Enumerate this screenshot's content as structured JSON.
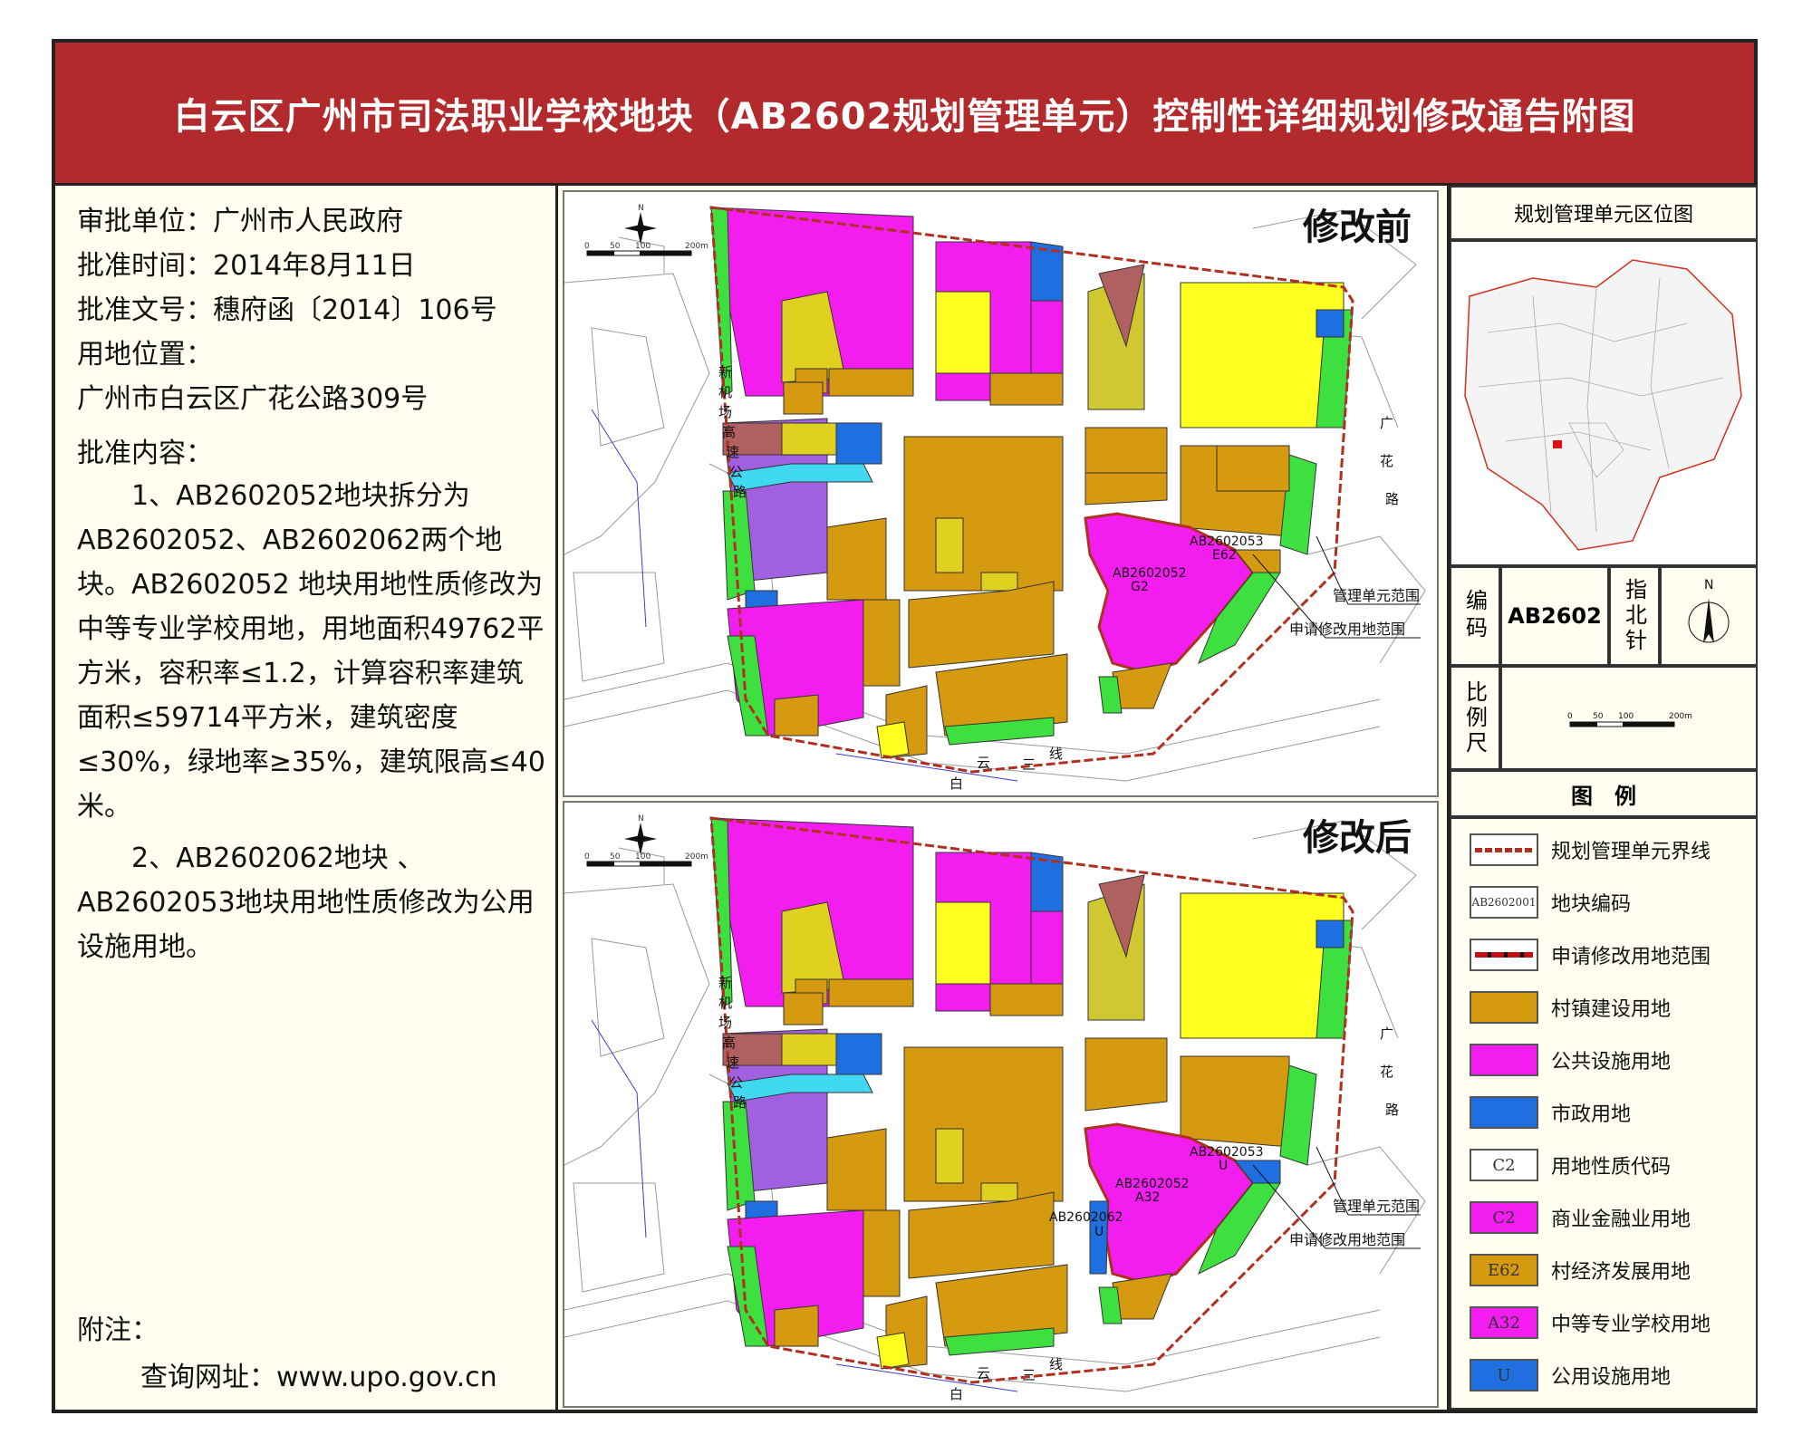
{
  "title": "白云区广州市司法职业学校地块（AB2602规划管理单元）控制性详细规划修改通告附图",
  "info": {
    "approval_unit": "审批单位：广州市人民政府",
    "approval_time": "批准时间：2014年8月11日",
    "approval_doc": "批准文号：穗府函〔2014〕106号",
    "location_label": "用地位置：",
    "location": "广州市白云区广花公路309号",
    "content_label": "批准内容：",
    "item1": "1、AB2602052地块拆分为AB2602052、AB2602062两个地块。AB2602052 地块用地性质修改为中等专业学校用地，用地面积49762平方米，容积率≤1.2，计算容积率建筑面积≤59714平方米，建筑密度≤30%，绿地率≥35%，建筑限高≤40米。",
    "item2": "2、AB2602062地块 、AB2602053地块用地性质修改为公用设施用地。",
    "note_label": "附注：",
    "website": "查询网址：www.upo.gov.cn"
  },
  "maps": {
    "before_title": "修改前",
    "after_title": "修改后",
    "road_labels": {
      "west_highway": [
        "新",
        "机",
        "场",
        "高",
        "速",
        "公",
        "路"
      ],
      "east_road": [
        "广",
        "花",
        "路"
      ],
      "south_line": [
        "白",
        "云",
        "三",
        "线"
      ]
    },
    "scale_ticks": [
      "0",
      "50",
      "100",
      "200m"
    ],
    "callout_boundary": "管理单元范围",
    "callout_request": "申请修改用地范围",
    "before_labels": {
      "parcel_52": "AB2602052",
      "code_52": "G2",
      "parcel_53": "AB2602053",
      "code_53": "E62"
    },
    "after_labels": {
      "parcel_52": "AB2602052",
      "code_52": "A32",
      "parcel_53": "AB2602053",
      "code_53": "U",
      "parcel_62": "AB2602062",
      "code_62": "U"
    }
  },
  "right": {
    "location_map_title": "规划管理单元区位图",
    "code_label": "编码",
    "code_value": "AB2602",
    "north_label": "指北针",
    "north_letter": "N",
    "scale_label": "比例尺",
    "scale_ticks": [
      "0",
      "50",
      "100",
      "200m"
    ],
    "legend_title": "图　例"
  },
  "legend": [
    {
      "swatch_text": "",
      "label": "规划管理单元界线",
      "kind": "boundary"
    },
    {
      "swatch_text": "AB2602001",
      "label": "地块编码",
      "kind": "code"
    },
    {
      "swatch_text": "",
      "label": "申请修改用地范围",
      "kind": "request"
    },
    {
      "swatch_text": "",
      "label": "村镇建设用地",
      "color": "#d59a10"
    },
    {
      "swatch_text": "",
      "label": "公共设施用地",
      "color": "#f31df0"
    },
    {
      "swatch_text": "",
      "label": "市政用地",
      "color": "#1f6fe0"
    },
    {
      "swatch_text": "C2",
      "label": "用地性质代码",
      "color": "#ffffff"
    },
    {
      "swatch_text": "C2",
      "label": "商业金融业用地",
      "color": "#f31df0"
    },
    {
      "swatch_text": "E62",
      "label": "村经济发展用地",
      "color": "#d59a10"
    },
    {
      "swatch_text": "A32",
      "label": "中等专业学校用地",
      "color": "#f31df0"
    },
    {
      "swatch_text": "U",
      "label": "公用设施用地",
      "color": "#1f6fe0"
    }
  ],
  "colors": {
    "title_bg": "#b22a2c",
    "village": "#d59a10",
    "public": "#f31df0",
    "municipal": "#1f6fe0",
    "green": "#3ee040",
    "residential": "#ffff20",
    "industrial": "#a060e0",
    "water": "#40d8f0",
    "brown": "#b06060",
    "boundary": "#b03020"
  }
}
